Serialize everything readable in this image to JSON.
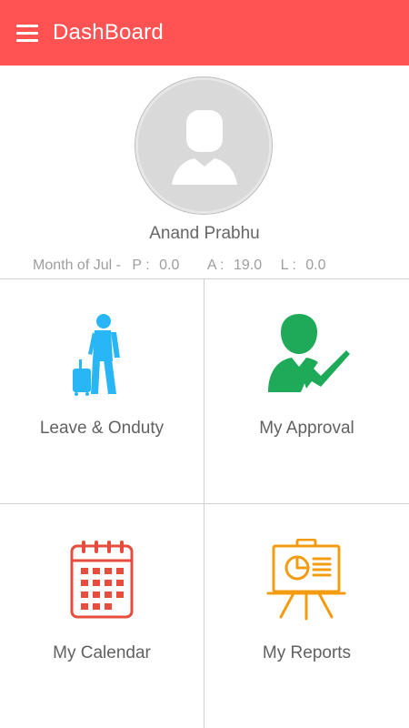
{
  "appbar": {
    "title": "DashBoard",
    "menu_icon": "hamburger-menu-icon",
    "color": "#ff5252"
  },
  "profile": {
    "avatar_icon": "user-silhouette-icon",
    "name": "Anand Prabhu",
    "stats": {
      "month_label": "Month of Jul -",
      "present_label": "P :",
      "present_value": "0.0",
      "absent_label": "A :",
      "absent_value": "19.0",
      "leave_label": "L :",
      "leave_value": "0.0"
    }
  },
  "tiles": [
    {
      "label": "Leave & Onduty",
      "icon": "traveler-luggage-icon",
      "color": "#29b6f6"
    },
    {
      "label": "My Approval",
      "icon": "person-checkmark-icon",
      "color": "#1faa59"
    },
    {
      "label": "My Calendar",
      "icon": "calendar-icon",
      "color": "#e74c3c"
    },
    {
      "label": "My Reports",
      "icon": "presentation-board-icon",
      "color": "#f39c12"
    }
  ]
}
